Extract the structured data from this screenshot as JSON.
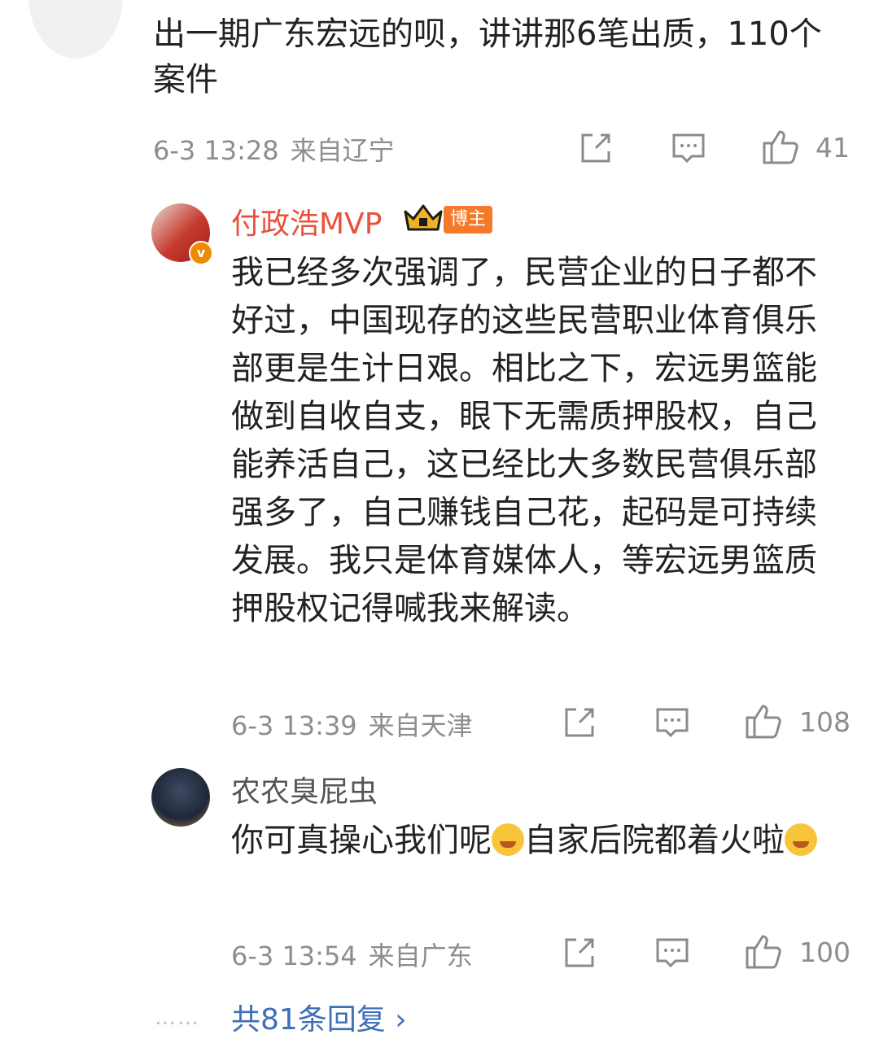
{
  "top_comment": {
    "text": "出一期广东宏远的呗，讲讲那6笔出质，110个案件",
    "time": "6-3 13:28",
    "location": "来自辽宁",
    "likes": "41"
  },
  "reply1": {
    "username": "付政浩MVP",
    "badge": "博主",
    "text": "我已经多次强调了，民营企业的日子都不好过，中国现存的这些民营职业体育俱乐部更是生计日艰。相比之下，宏远男篮能做到自收自支，眼下无需质押股权，自己能养活自己，这已经比大多数民营俱乐部强多了，自己赚钱自己花，起码是可持续发展。我只是体育媒体人，等宏远男篮质押股权记得喊我来解读。",
    "time": "6-3 13:39",
    "location": "来自天津",
    "likes": "108"
  },
  "reply2": {
    "username": "农农臭屁虫",
    "text_part1": "你可真操心我们呢",
    "text_part2": "自家后院都着火啦",
    "time": "6-3 13:54",
    "location": "来自广东",
    "likes": "100"
  },
  "footer": {
    "dots": "……",
    "more_replies": "共81条回复 ›"
  },
  "icons": {
    "share": "share-icon",
    "comment": "comment-icon",
    "like": "thumbs-up-icon"
  }
}
